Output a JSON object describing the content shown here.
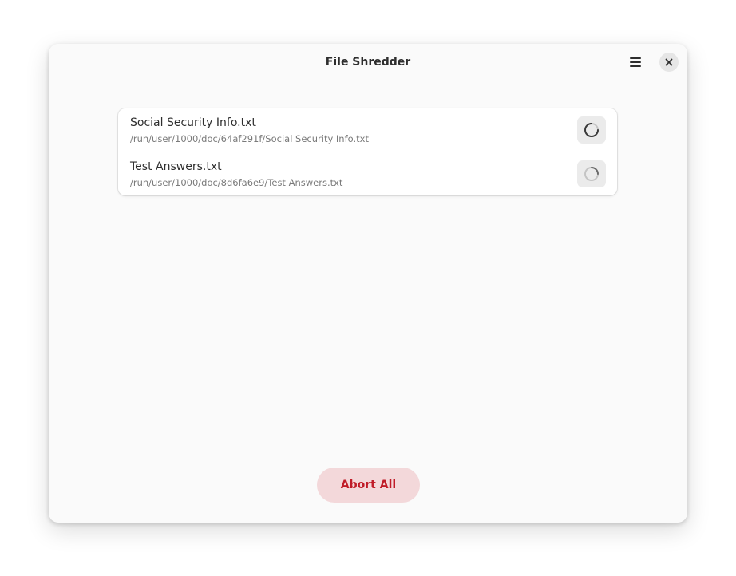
{
  "window": {
    "title": "File Shredder"
  },
  "header": {
    "menu_icon": "hamburger-menu-icon",
    "close_icon": "close-icon"
  },
  "files": [
    {
      "name": "Social Security Info.txt",
      "path": "/run/user/1000/doc/64af291f/Social Security Info.txt",
      "status_icon": "spinner-icon"
    },
    {
      "name": "Test Answers.txt",
      "path": "/run/user/1000/doc/8d6fa6e9/Test Answers.txt",
      "status_icon": "spinner-icon"
    }
  ],
  "footer": {
    "abort_label": "Abort All"
  },
  "colors": {
    "destructive": "#c01c28",
    "destructive_bg": "#f3d8da",
    "window_bg": "#fafafa"
  }
}
